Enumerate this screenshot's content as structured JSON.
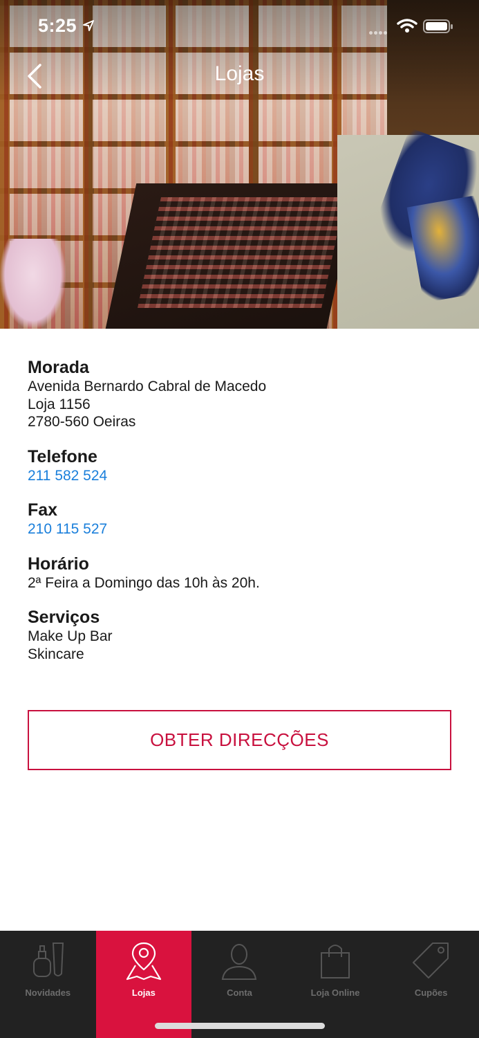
{
  "status_bar": {
    "time": "5:25"
  },
  "header": {
    "title": "Lojas"
  },
  "sections": {
    "morada": {
      "title": "Morada",
      "lines": [
        "Avenida Bernardo Cabral de Macedo",
        "Loja 1156",
        "2780-560 Oeiras"
      ]
    },
    "telefone": {
      "title": "Telefone",
      "value": "211 582 524"
    },
    "fax": {
      "title": "Fax",
      "value": "210 115 527"
    },
    "horario": {
      "title": "Horário",
      "value": "2ª Feira a Domingo das 10h às 20h."
    },
    "servicos": {
      "title": "Serviços",
      "lines": [
        "Make Up Bar",
        "Skincare"
      ]
    }
  },
  "directions_button": {
    "label": "OBTER DIRECÇÕES"
  },
  "tabs": [
    {
      "label": "Novidades",
      "icon": "perfume-icon",
      "active": false
    },
    {
      "label": "Lojas",
      "icon": "map-pin-icon",
      "active": true
    },
    {
      "label": "Conta",
      "icon": "user-icon",
      "active": false
    },
    {
      "label": "Loja Online",
      "icon": "shopping-bag-icon",
      "active": false
    },
    {
      "label": "Cupões",
      "icon": "tag-icon",
      "active": false
    }
  ],
  "colors": {
    "accent": "#c8103e",
    "tab_active": "#d9123e",
    "link": "#1a7fdb",
    "tabbar_bg": "#222222"
  }
}
